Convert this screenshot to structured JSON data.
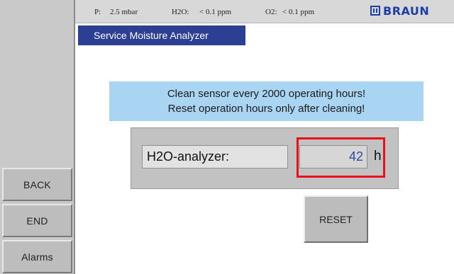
{
  "statusbar": {
    "p_label": "P:",
    "p_value": "2.5 mbar",
    "h2o_label": "H2O:",
    "h2o_value": "< 0.1 ppm",
    "o2_label": "O2:",
    "o2_value": "< 0.1 ppm",
    "brand": "BRAUN"
  },
  "title": "Service Moisture Analyzer",
  "notice": {
    "line1": "Clean sensor every 2000 operating hours!",
    "line2": "Reset operation hours only after cleaning!"
  },
  "analyzer": {
    "label": "H2O-analyzer:",
    "hours_value": "42",
    "unit": "h"
  },
  "buttons": {
    "back": "BACK",
    "end": "END",
    "alarms": "Alarms",
    "reset": "RESET"
  },
  "colors": {
    "title_bar": "#2c3f93",
    "notice_bg": "#a9d4f2",
    "highlight": "#e8101a",
    "brand": "#1f3fa8",
    "hours_text": "#2f49a6"
  }
}
